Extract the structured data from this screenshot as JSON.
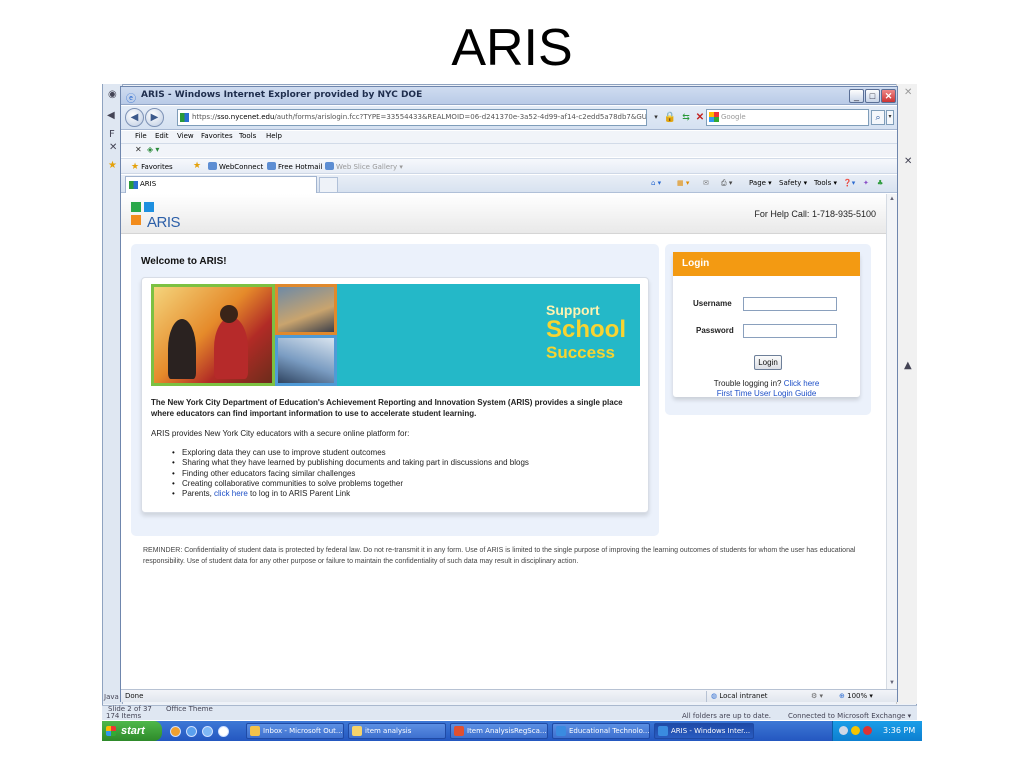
{
  "slide": {
    "title": "ARIS"
  },
  "window": {
    "title": "ARIS - Windows Internet Explorer provided by NYC DOE",
    "minimize": "_",
    "maximize": "□",
    "close": "✕"
  },
  "address": {
    "url_prefix": "https://",
    "url_domain": "sso.nycenet.edu",
    "url_rest": "/auth/forms/arislogin.fcc?TYPE=33554433&REALMOID=06-d241370e-3a52-4d99-af14-c2edd5a78db7&GUID=&SMAUT",
    "search_placeholder": "Google"
  },
  "menu": [
    "File",
    "Edit",
    "View",
    "Favorites",
    "Tools",
    "Help"
  ],
  "favorites_bar": {
    "favorites": "Favorites",
    "items": [
      "WebConnect",
      "Free Hotmail",
      "Web Slice Gallery ▾"
    ]
  },
  "tab": {
    "title": "ARIS"
  },
  "toolbar": {
    "page": "Page ▾",
    "safety": "Safety ▾",
    "tools": "Tools ▾"
  },
  "page": {
    "logo_text": "ARIS",
    "help_call": "For Help Call: 1-718-935-5100",
    "welcome_title": "Welcome to ARIS!",
    "banner": {
      "line1": "Support",
      "line2": "School",
      "line3": "Success"
    },
    "intro_bold": "The New York City Department of Education's Achievement Reporting and Innovation System (ARIS) provides a single place where educators can find important information to use to accelerate student learning.",
    "intro_plain": "ARIS provides New York City educators with a secure online platform for:",
    "features": [
      "Exploring data they can use to improve student outcomes",
      "Sharing what they have learned by publishing documents and taking part in discussions and blogs",
      "Finding other educators facing similar challenges",
      "Creating collaborative communities to solve problems together"
    ],
    "parents_prefix": "Parents, ",
    "parents_link": "click here",
    "parents_suffix": " to log in to ARIS Parent Link",
    "reminder": "REMINDER: Confidentiality of student data is protected by federal law. Do not re-transmit it in any form. Use of ARIS is limited to the single purpose of improving the learning outcomes of students for whom the user has educational responsibility. Use of student data for any other purpose or failure to maintain the confidentiality of such data may result in disciplinary action."
  },
  "login": {
    "header": "Login",
    "username_label": "Username",
    "password_label": "Password",
    "button": "Login",
    "trouble_prefix": "Trouble logging in? ",
    "trouble_link": "Click here",
    "first_time_link": "First Time User Login Guide"
  },
  "status": {
    "done": "Done",
    "zone": "Local intranet",
    "zoom": "100%"
  },
  "background": {
    "left_label": "Java",
    "slide_info": "Slide 2 of 37",
    "theme": "Office Theme",
    "items_count": "174 Items",
    "sync_left": "All folders are up to date.",
    "sync_right": "Connected to Microsoft Exchange ▾"
  },
  "taskbar": {
    "start": "start",
    "items": [
      "Inbox - Microsoft Out...",
      "item analysis",
      "Item AnalysisRegSca...",
      "Educational Technolo...",
      "ARIS - Windows Inter..."
    ],
    "clock": "3:36 PM"
  }
}
